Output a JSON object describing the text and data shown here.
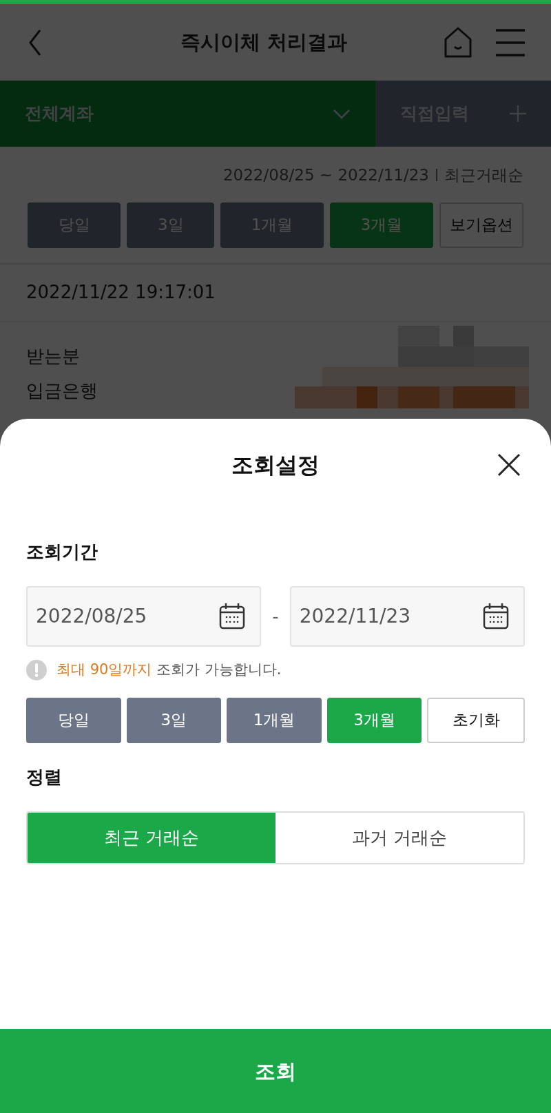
{
  "header": {
    "title": "즉시이체 처리결과"
  },
  "account_tabs": [
    {
      "label": "전체계좌",
      "kind": "dropdown",
      "selected": true
    },
    {
      "label": "직접입력",
      "kind": "add",
      "selected": false
    }
  ],
  "range_summary": {
    "dates": "2022/08/25 ~ 2022/11/23",
    "order": "최근거래순"
  },
  "period_buttons": [
    {
      "label": "당일",
      "selected": false
    },
    {
      "label": "3일",
      "selected": false
    },
    {
      "label": "1개월",
      "selected": false
    },
    {
      "label": "3개월",
      "selected": true
    }
  ],
  "view_options_button": "보기옵션",
  "transaction": {
    "timestamp": "2022/11/22 19:17:01",
    "fields": [
      {
        "label": "받는분"
      },
      {
        "label": "입금은행"
      }
    ]
  },
  "sheet": {
    "title": "조회설정",
    "period_label": "조회기간",
    "start_date": "2022/08/25",
    "separator": "-",
    "end_date": "2022/11/23",
    "notice_highlight": "최대 90일까지",
    "notice_text": "조회가 가능합니다.",
    "period_buttons": [
      {
        "label": "당일",
        "selected": false
      },
      {
        "label": "3일",
        "selected": false
      },
      {
        "label": "1개월",
        "selected": false
      },
      {
        "label": "3개월",
        "selected": true
      }
    ],
    "reset_button": "초기화",
    "sort_label": "정렬",
    "sort_options": [
      {
        "label": "최근 거래순",
        "selected": true
      },
      {
        "label": "과거 거래순",
        "selected": false
      }
    ],
    "submit_button": "조회"
  }
}
